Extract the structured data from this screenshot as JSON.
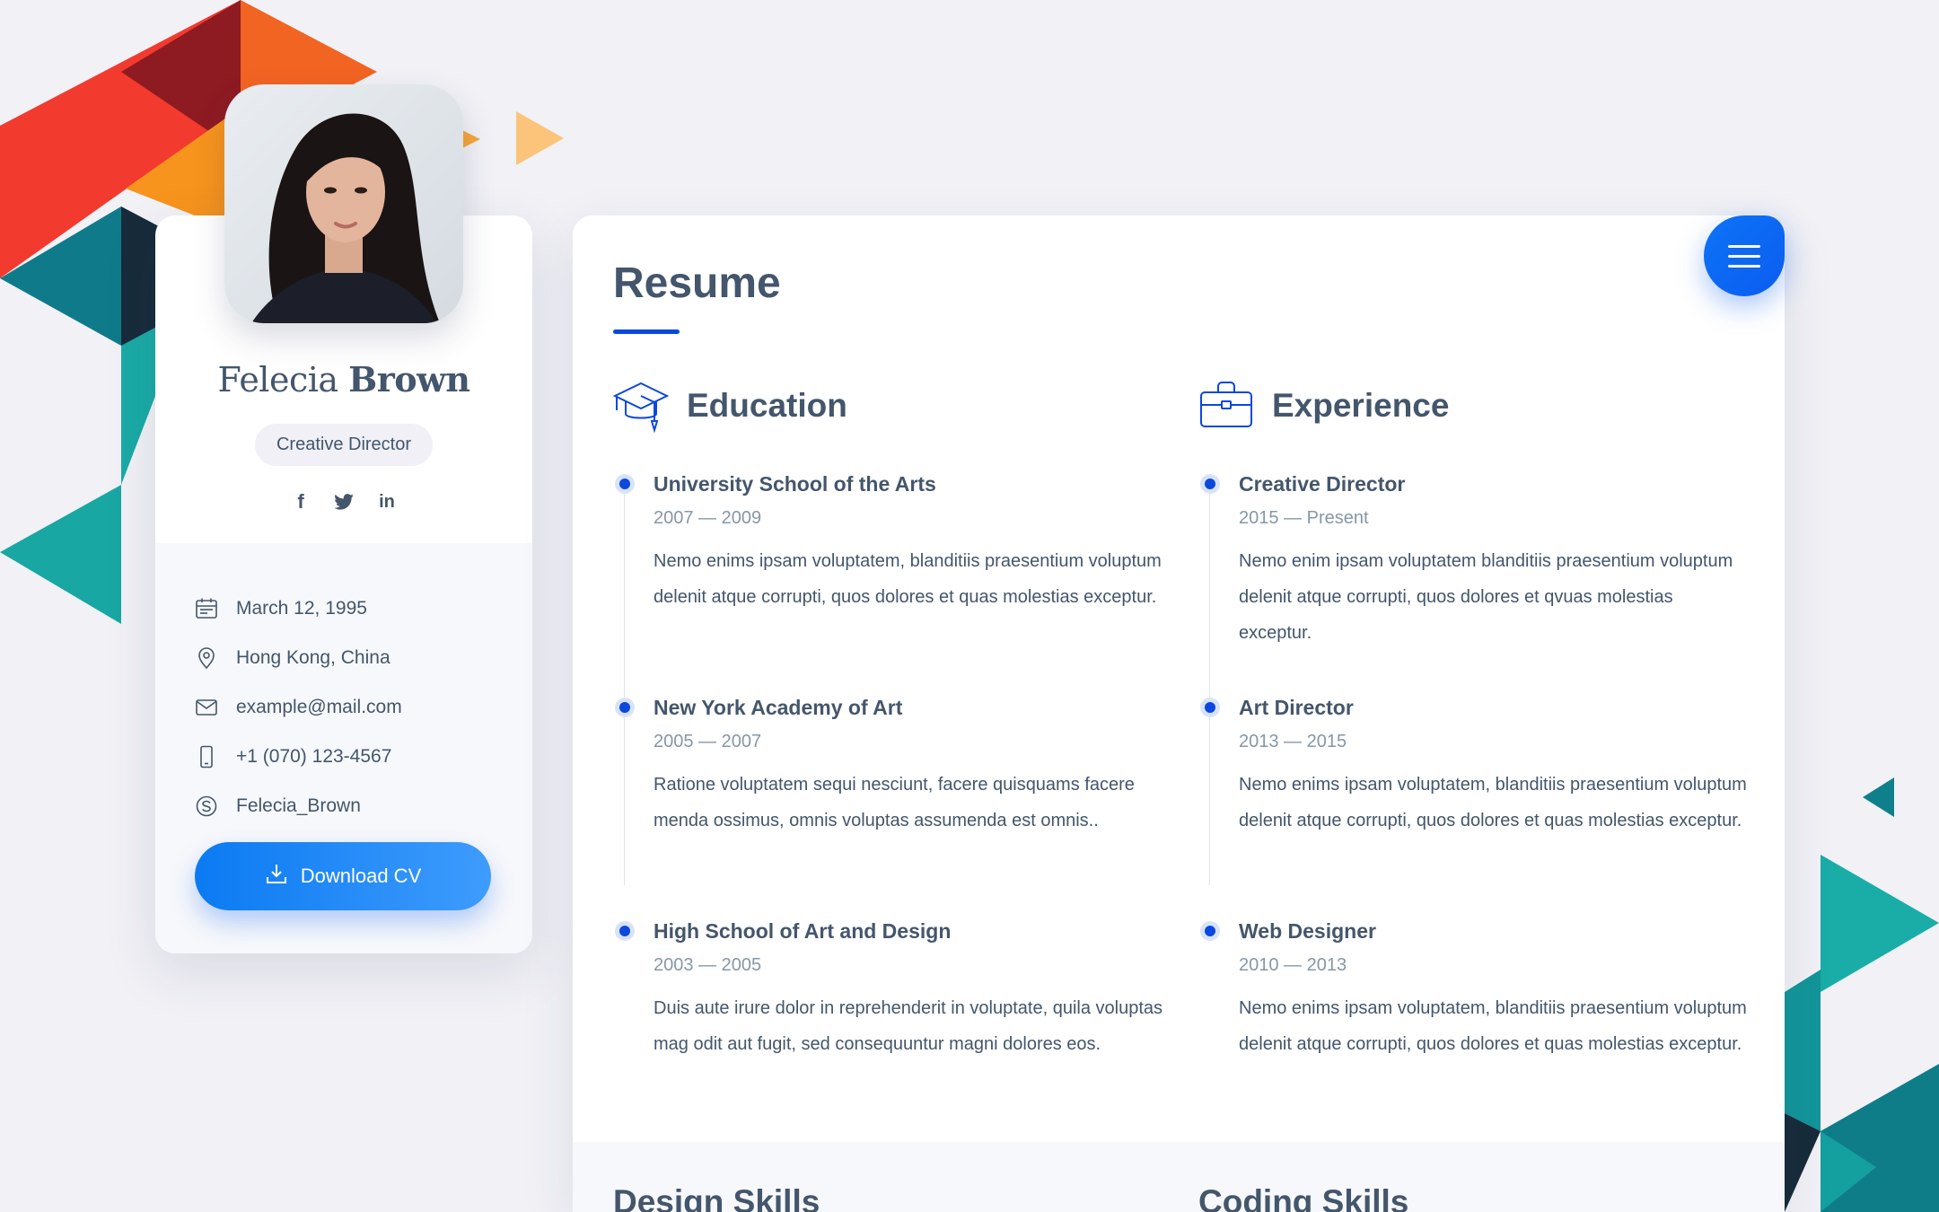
{
  "profile": {
    "first_name": "Felecia",
    "last_name": "Brown",
    "role": "Creative Director",
    "social": [
      {
        "icon": "facebook-icon",
        "glyph": "f"
      },
      {
        "icon": "twitter-icon",
        "glyph": ""
      },
      {
        "icon": "linkedin-icon",
        "glyph": "in"
      }
    ],
    "contacts": [
      {
        "icon": "calendar-icon",
        "value": "March 12, 1995"
      },
      {
        "icon": "location-pin-icon",
        "value": "Hong Kong, China"
      },
      {
        "icon": "mail-icon",
        "value": "example@mail.com"
      },
      {
        "icon": "phone-icon",
        "value": "+1 (070) 123-4567"
      },
      {
        "icon": "skype-icon",
        "value": "Felecia_Brown"
      }
    ],
    "download_label": "Download CV"
  },
  "resume": {
    "title": "Resume",
    "education": {
      "title": "Education",
      "items": [
        {
          "title": "University School of the Arts",
          "period": "2007 — 2009",
          "text": "Nemo enims ipsam voluptatem, blanditiis praesentium voluptum delenit atque corrupti, quos dolores et quas molestias exceptur."
        },
        {
          "title": "New York Academy of Art",
          "period": "2005 — 2007",
          "text": "Ratione voluptatem sequi nesciunt, facere quisquams facere menda ossimus, omnis voluptas assumenda est omnis.."
        },
        {
          "title": "High School of Art and Design",
          "period": "2003 — 2005",
          "text": "Duis aute irure dolor in reprehenderit in voluptate, quila voluptas mag odit aut fugit, sed consequuntur magni dolores eos."
        }
      ]
    },
    "experience": {
      "title": "Experience",
      "items": [
        {
          "title": "Creative Director",
          "period": "2015 — Present",
          "text": "Nemo enim ipsam voluptatem blanditiis praesentium voluptum delenit atque corrupti, quos dolores et qvuas molestias exceptur."
        },
        {
          "title": "Art Director",
          "period": "2013 — 2015",
          "text": "Nemo enims ipsam voluptatem, blanditiis praesentium voluptum delenit atque corrupti, quos dolores et quas molestias exceptur."
        },
        {
          "title": "Web Designer",
          "period": "2010 — 2013",
          "text": "Nemo enims ipsam voluptatem, blanditiis praesentium voluptum delenit atque corrupti, quos dolores et quas molestias exceptur."
        }
      ]
    },
    "design_skills_title": "Design Skills",
    "coding_skills_title": "Coding Skills"
  },
  "colors": {
    "accent": "#0b48dd",
    "button": "#0b7af2",
    "text": "#44566c",
    "muted": "#8697a8",
    "background": "#f1f1f6"
  }
}
